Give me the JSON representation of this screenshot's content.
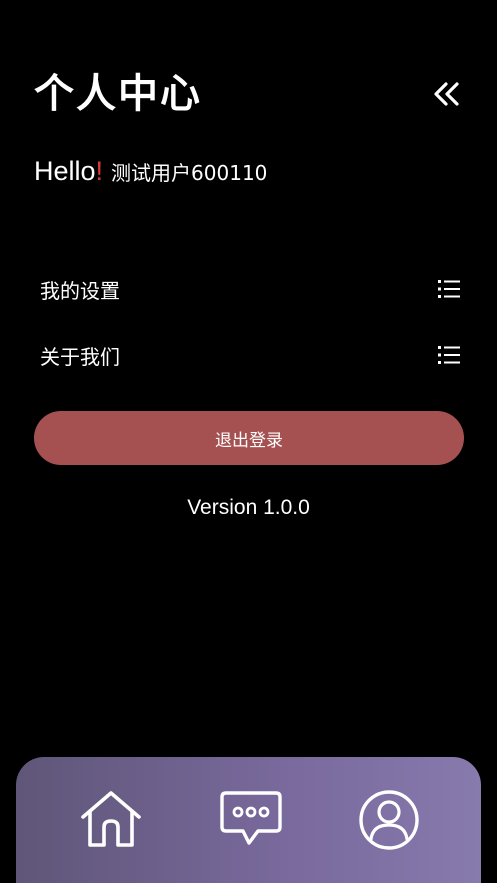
{
  "header": {
    "title": "个人中心",
    "back_icon": "double-chevron-left-icon"
  },
  "greeting": {
    "hello": "Hello",
    "exclaim": "!",
    "exclaim_color": "#d93a3a",
    "username": "测试用户600110"
  },
  "menu": {
    "items": [
      {
        "label": "我的设置",
        "icon": "list-icon"
      },
      {
        "label": "关于我们",
        "icon": "list-icon"
      }
    ]
  },
  "logout": {
    "label": "退出登录",
    "color": "#a65151"
  },
  "version": "Version 1.0.0",
  "bottom_nav": {
    "items": [
      {
        "icon": "home-icon"
      },
      {
        "icon": "message-icon"
      },
      {
        "icon": "user-icon"
      }
    ],
    "gradient": [
      "#5f5678",
      "#877aad"
    ]
  }
}
